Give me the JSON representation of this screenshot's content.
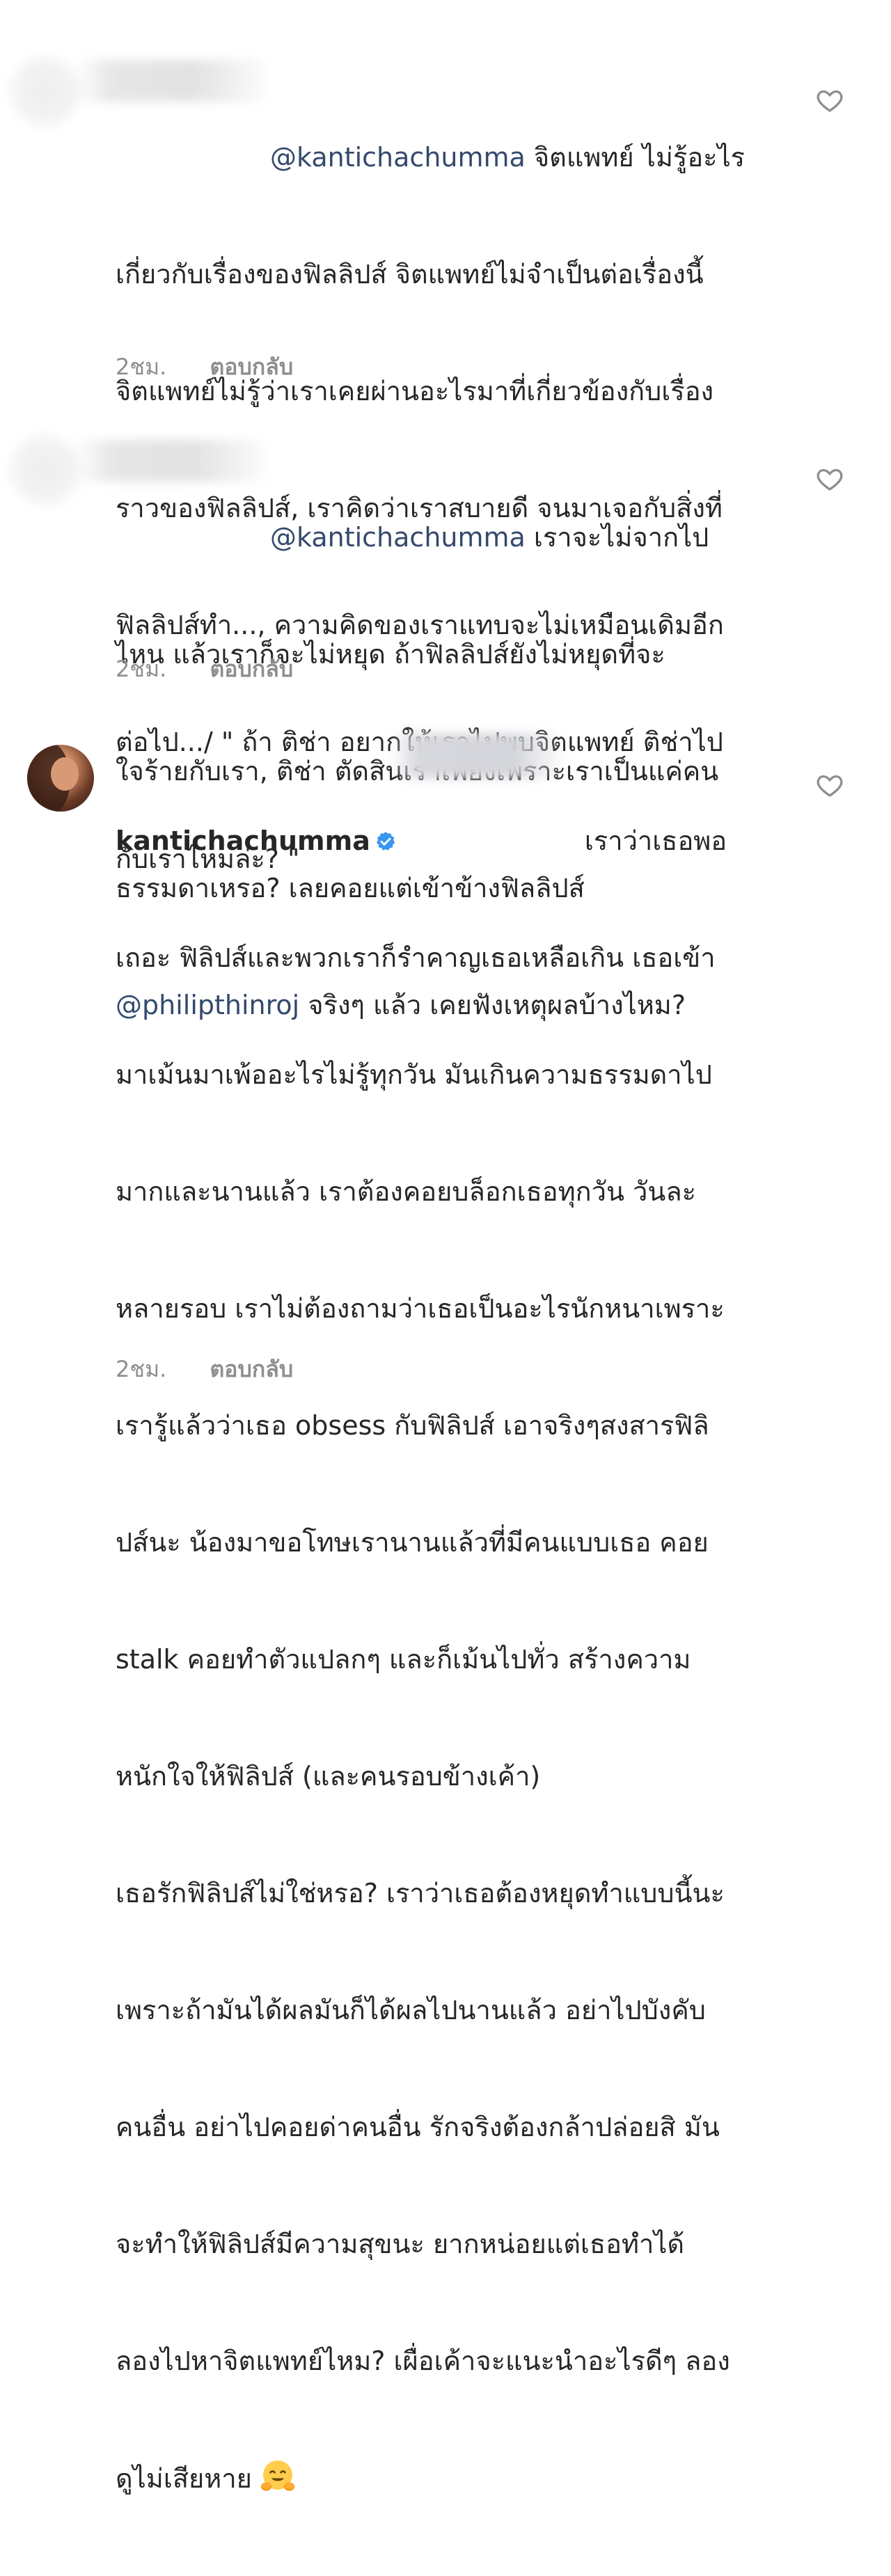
{
  "comments": [
    {
      "mention": "@kantichachumma",
      "lines": [
        " จิตแพทย์ ไม่รู้อะไร",
        "เกี่ยวกับเรื่องของฟิลลิปส์ จิตแพทย์ไม่จำเป็นต่อเรื่องนี้",
        "จิตแพทย์ไม่รู้ว่าเราเคยผ่านอะไรมาที่เกี่ยวข้องกับเรื่อง",
        "ราวของฟิลลิปส์, เราคิดว่าเราสบายดี จนมาเจอกับสิ่งที่",
        "ฟิลลิปส์ทำ..., ความคิดของเราแทบจะไม่เหมือนเดิมอีก",
        "ต่อไป.../ \" ถ้า ติช่า อยากให้เราไปพบจิตแพทย์ ติช่าไป",
        "กับเราไหมล่ะ? \""
      ],
      "time": "2ชม.",
      "reply": "ตอบกลับ"
    },
    {
      "mention": "@kantichachumma",
      "lines": [
        " เราจะไม่จากไป",
        "ไหน แล้วเราก็จะไม่หยุด ถ้าฟิลลิปส์ยังไม่หยุดที่จะ",
        "ใจร้ายกับเรา, ติช่า ตัดสินเราเพียงเพราะเราเป็นแค่คน",
        "ธรรมดาเหรอ? เลยคอยแต่เข้าข้างฟิลลิปส์"
      ],
      "mention2": "@philipthinroj",
      "line_after_mention2": " จริงๆ แล้ว เคยฟังเหตุผลบ้างไหม?",
      "time": "2ชม.",
      "reply": "ตอบกลับ"
    },
    {
      "username": "kantichachumma",
      "first_line_tail": "เราว่าเธอพอ",
      "lines": [
        "เถอะ ฟิลิปส์และพวกเราก็รำคาญเธอเหลือเกิน เธอเข้า",
        "มาเม้นมาเพ้ออะไรไม่รู้ทุกวัน มันเกินความธรรมดาไป",
        "มากและนานแล้ว เราต้องคอยบล็อกเธอทุกวัน วันละ",
        "หลายรอบ เราไม่ต้องถามว่าเธอเป็นอะไรนักหนาเพราะ",
        "เรารู้แล้วว่าเธอ obsess กับฟิลิปส์ เอาจริงๆสงสารฟิลิ",
        "ปส์นะ น้องมาขอโทษเรานานแล้วที่มีคนแบบเธอ คอย",
        "stalk คอยทำตัวแปลกๆ และก็เม้นไปทั่ว สร้างความ",
        "หนักใจให้ฟิลิปส์ (และคนรอบข้างเค้า)",
        "เธอรักฟิลิปส์ไม่ใช่หรอ? เราว่าเธอต้องหยุดทำแบบนี้นะ",
        "เพราะถ้ามันได้ผลมันก็ได้ผลไปนานแล้ว อย่าไปบังคับ",
        "คนอื่น อย่าไปคอยด่าคนอื่น รักจริงต้องกล้าปล่อยสิ มัน",
        "จะทำให้ฟิลิปส์มีความสุขนะ ยากหน่อยแต่เธอทำได้",
        "ลองไปหาจิตแพทย์ไหม? เผื่อเค้าจะแนะนำอะไรดีๆ ลอง",
        "ดูไม่เสียหาย"
      ],
      "time": "2ชม.",
      "reply": "ตอบกลับ",
      "emoji": "hugging-face-emoji"
    }
  ],
  "icons": {
    "like": "heart-outline-icon",
    "verified": "verified-badge-icon"
  },
  "colors": {
    "text": "#262626",
    "mention": "#34496d",
    "meta": "#8e8e8e",
    "verified": "#3897f0"
  }
}
